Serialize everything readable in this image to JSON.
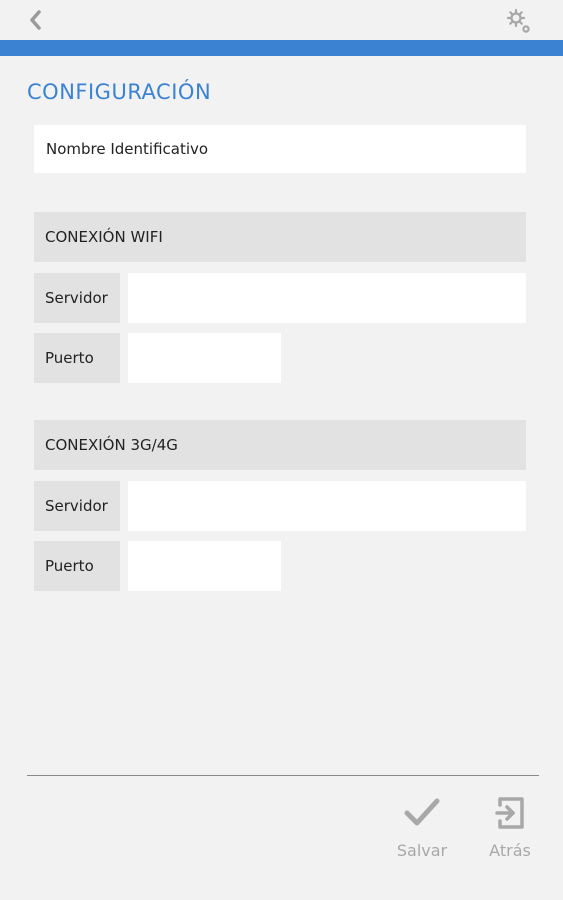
{
  "header": {
    "back_icon": "chevron-left-icon",
    "settings_icon": "gear-icon",
    "accent_color": "#3b83d2"
  },
  "config": {
    "title": "CONFIGURACIÓN",
    "name_placeholder": "Nombre Identificativo"
  },
  "wifi": {
    "header": "CONEXIÓN WIFI",
    "server_label": "Servidor",
    "server_value": "",
    "port_label": "Puerto",
    "port_value": ""
  },
  "mobile": {
    "header": "CONEXIÓN 3G/4G",
    "server_label": "Servidor",
    "server_value": "",
    "port_label": "Puerto",
    "port_value": ""
  },
  "footer": {
    "save_label": "Salvar",
    "save_icon": "checkmark-icon",
    "back_label": "Atrás",
    "back_icon": "exit-icon"
  }
}
